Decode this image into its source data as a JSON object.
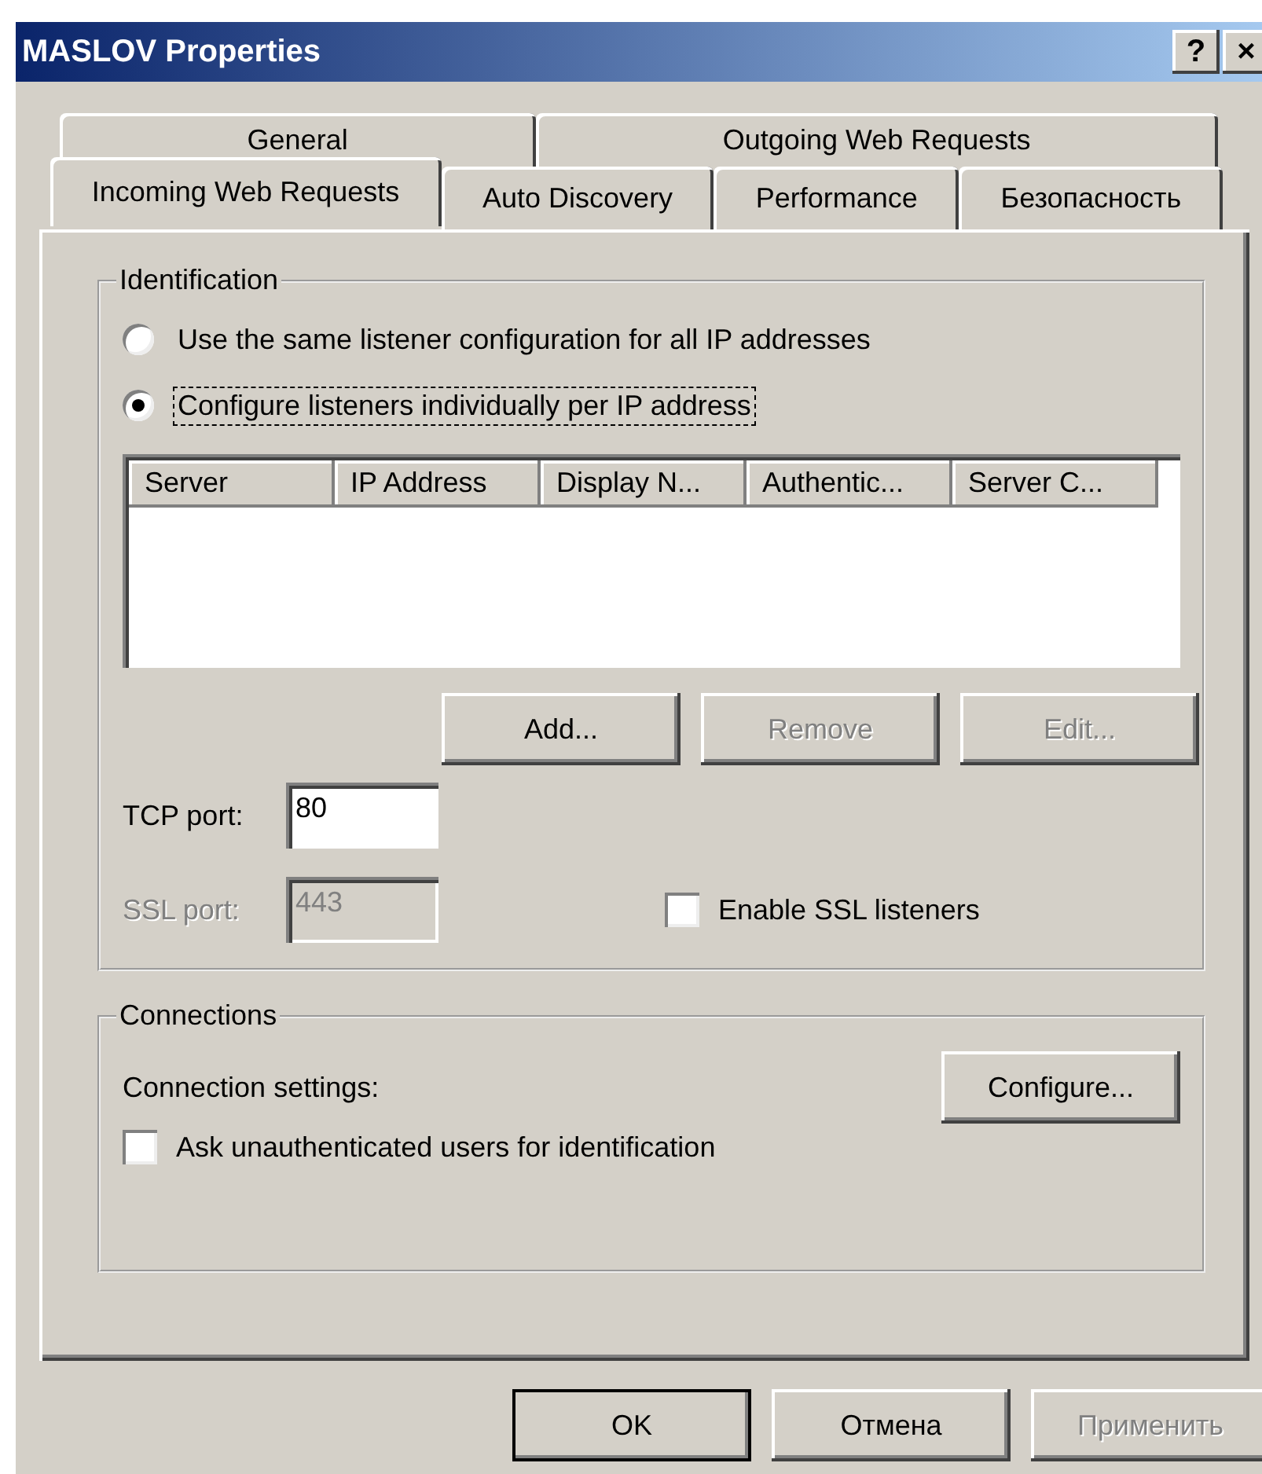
{
  "window": {
    "title": "MASLOV Properties",
    "help_button": "?",
    "close_button": "×"
  },
  "tab_rows": [
    [
      {
        "label": "General",
        "selected": false
      },
      {
        "label": "Outgoing Web Requests",
        "selected": false
      }
    ],
    [
      {
        "label": "Incoming Web Requests",
        "selected": true
      },
      {
        "label": "Auto Discovery",
        "selected": false
      },
      {
        "label": "Performance",
        "selected": false
      },
      {
        "label": "Безопасность",
        "selected": false
      }
    ]
  ],
  "identification": {
    "title": "Identification",
    "radios": [
      {
        "label": "Use the same listener configuration for all IP addresses",
        "selected": false,
        "focused": false
      },
      {
        "label": "Configure listeners individually per IP address",
        "selected": true,
        "focused": true
      }
    ],
    "table": {
      "columns": [
        "Server",
        "IP Address",
        "Display N...",
        "Authentic...",
        "Server C..."
      ]
    },
    "buttons": [
      {
        "label": "Add...",
        "disabled": false
      },
      {
        "label": "Remove",
        "disabled": true
      },
      {
        "label": "Edit...",
        "disabled": true
      }
    ],
    "tcp_port": {
      "label": "TCP port:",
      "value": "80",
      "disabled": false
    },
    "ssl_port": {
      "label": "SSL port:",
      "value": "443",
      "disabled": true
    },
    "enable_ssl": {
      "label": "Enable SSL listeners",
      "checked": false
    }
  },
  "connections": {
    "title": "Connections",
    "settings_label": "Connection settings:",
    "configure_button": "Configure...",
    "ask_checkbox": {
      "label": "Ask unauthenticated users for identification",
      "checked": false
    }
  },
  "buttons": [
    {
      "label": "OK",
      "default": true,
      "disabled": false
    },
    {
      "label": "Отмена",
      "default": false,
      "disabled": false
    },
    {
      "label": "Применить",
      "default": false,
      "disabled": true
    }
  ]
}
